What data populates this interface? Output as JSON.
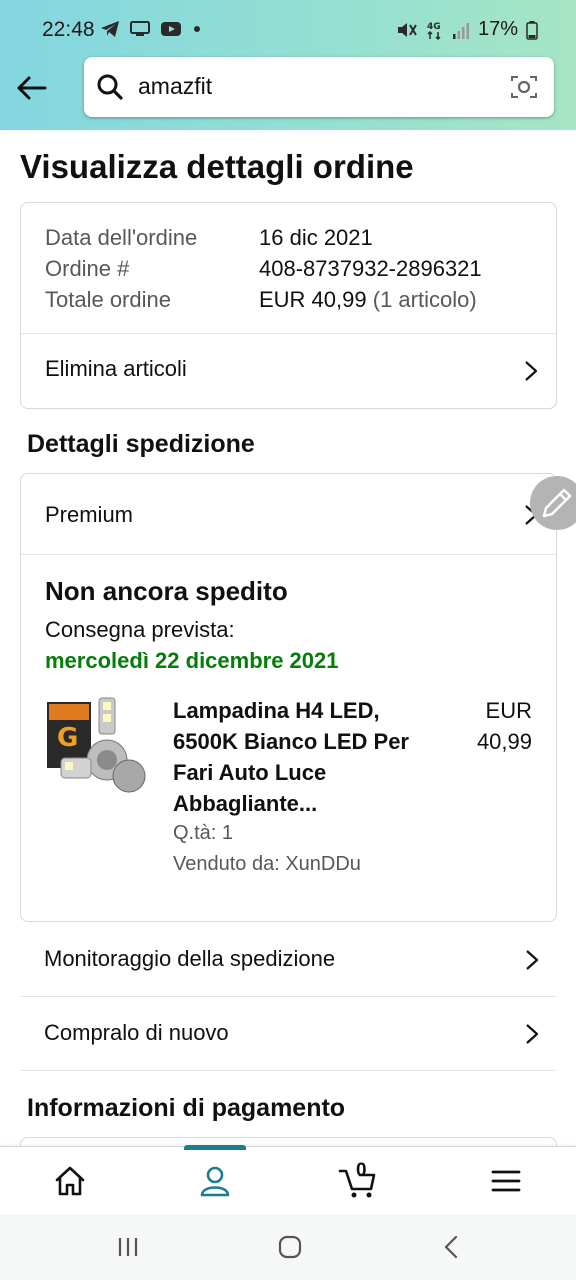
{
  "status_bar": {
    "time": "22:48",
    "battery": "17%",
    "network": "4G"
  },
  "search": {
    "query": "amazfit"
  },
  "page": {
    "title": "Visualizza dettagli ordine"
  },
  "order_summary": {
    "rows": [
      {
        "label": "Data dell'ordine",
        "value": "16 dic 2021",
        "extra": ""
      },
      {
        "label": "Ordine #",
        "value": "408-8737932-2896321",
        "extra": ""
      },
      {
        "label": "Totale ordine",
        "value": "EUR 40,99",
        "extra": "(1 articolo)"
      }
    ],
    "delete_items_label": "Elimina articoli"
  },
  "shipping": {
    "section_title": "Dettagli spedizione",
    "method": "Premium",
    "status": "Non ancora spedito",
    "delivery_label": "Consegna prevista:",
    "delivery_date": "mercoledì 22 dicembre 2021",
    "product": {
      "name": "Lampadina H4 LED, 6500K Bianco LED Per Fari Auto Luce Abbagliante...",
      "price_currency": "EUR",
      "price_amount": "40,99",
      "quantity": "Q.tà: 1",
      "seller": "Venduto da: XunDDu"
    },
    "track_label": "Monitoraggio della spedizione",
    "buy_again_label": "Compralo di nuovo"
  },
  "payment": {
    "section_title": "Informazioni di pagamento"
  },
  "bottom_nav": {
    "items": [
      "home-icon",
      "account-icon",
      "cart-icon",
      "menu-icon"
    ],
    "cart_count": "0",
    "active": "account-icon"
  },
  "colors": {
    "header_start": "#83d6e0",
    "header_end": "#a6e5c5",
    "delivery_green": "#067d0a",
    "active_nav": "#1c7d8e"
  }
}
